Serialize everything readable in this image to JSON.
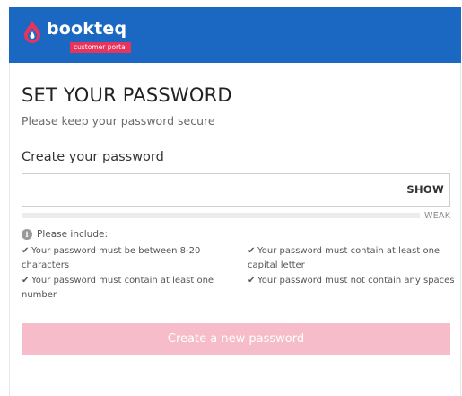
{
  "brand": {
    "name": "bookteq",
    "subtitle": "customer portal",
    "header_color": "#1a68c2",
    "accent_color": "#e8335c"
  },
  "page": {
    "title": "SET YOUR PASSWORD",
    "subtitle": "Please keep your password secure"
  },
  "password_field": {
    "label": "Create your password",
    "value": "",
    "placeholder": "",
    "toggle_label": "SHOW"
  },
  "strength": {
    "label": "WEAK",
    "level": 0
  },
  "requirements": {
    "heading": "Please include:",
    "icon": "info-icon",
    "check_icon": "check-icon",
    "items": [
      "Your password must be between 8-20 characters",
      "Your password must contain at least one number",
      "Your password must contain at least one capital letter",
      "Your password must not contain any spaces"
    ]
  },
  "submit": {
    "label": "Create a new password",
    "disabled_color": "#f6bcc9"
  }
}
